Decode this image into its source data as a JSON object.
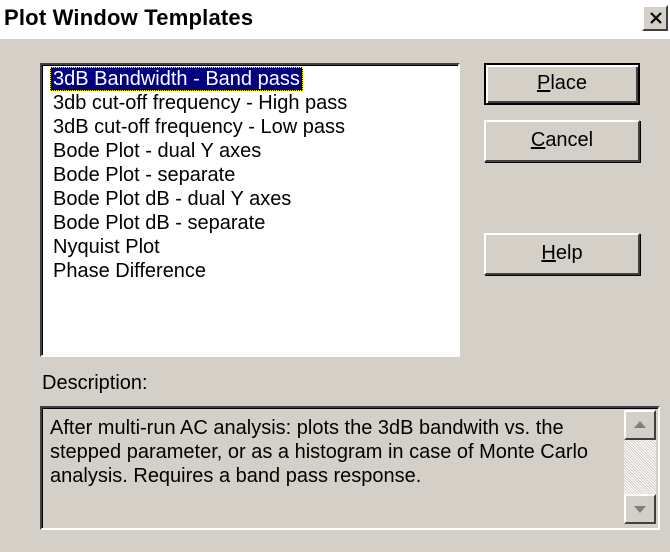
{
  "window": {
    "title": "Plot Window Templates"
  },
  "templates": {
    "items": [
      "3dB Bandwidth - Band pass",
      "3db cut-off frequency - High pass",
      "3dB cut-off frequency - Low pass",
      "Bode Plot - dual Y axes",
      "Bode Plot - separate",
      "Bode Plot dB - dual Y axes",
      "Bode Plot dB - separate",
      "Nyquist Plot",
      "Phase Difference"
    ],
    "selected_index": 0
  },
  "buttons": {
    "place": {
      "accel": "P",
      "rest": "lace"
    },
    "cancel": {
      "accel": "C",
      "rest": "ancel"
    },
    "help": {
      "accel": "H",
      "rest": "elp"
    }
  },
  "description": {
    "label": "Description:",
    "text": "After multi-run AC analysis: plots the 3dB bandwith vs. the stepped parameter, or as a histogram in case of Monte Carlo analysis. Requires a band pass response."
  },
  "icons": {
    "close": "close-icon",
    "scroll_up": "arrow-up-icon",
    "scroll_down": "arrow-down-icon"
  },
  "colors": {
    "face": "#d4d0c8",
    "selection": "#000080",
    "selection_text": "#ffffff"
  }
}
